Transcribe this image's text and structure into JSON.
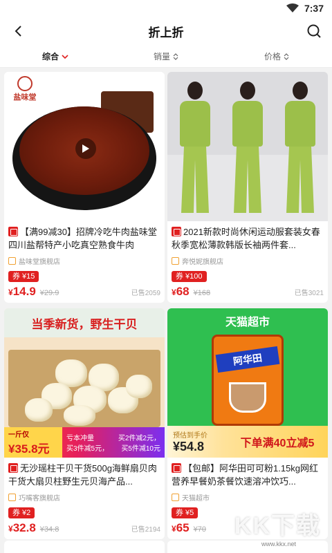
{
  "status_bar": {
    "time": "7:37"
  },
  "header": {
    "title": "折上折"
  },
  "sort": [
    {
      "label": "综合",
      "active": true
    },
    {
      "label": "销量",
      "active": false
    },
    {
      "label": "价格",
      "active": false
    }
  ],
  "products": [
    {
      "title": "【满99减30】招牌冷吃牛肉盐味堂四川盐帮特产小吃真空熟食牛肉",
      "shop": "盐味堂旗舰店",
      "coupon": "券 ¥15",
      "price": "14.9",
      "old_price": "¥29.9",
      "sold": "已售2059",
      "image_logo": "盐味堂"
    },
    {
      "title": "2021新款时尚休闲运动服套装女春秋季宽松薄款韩版长袖两件套...",
      "shop": "奔悦妮旗舰店",
      "coupon": "券 ¥100",
      "price": "68",
      "old_price": "¥168",
      "sold": "已售3021"
    },
    {
      "title": "无沙瑶柱干贝干货500g海鲜扇贝肉干货大扇贝柱野生元贝海产品...",
      "shop": "巧嘴客旗舰店",
      "coupon": "券 ¥2",
      "price": "32.8",
      "old_price": "¥34.8",
      "sold": "已售2194",
      "image_banner": "当季新货，野生干贝",
      "image_price_small": "一斤仅",
      "image_price_big": "¥35.8元",
      "image_tags": [
        "亏本冲量",
        "买2件减2元，",
        "买3件减5元，",
        "买5件减10元"
      ]
    },
    {
      "title": "【包邮】阿华田可可粉1.15kg网红营养早餐奶茶餐饮速溶冲饮巧...",
      "shop": "天猫超市",
      "coupon": "券 ¥5",
      "price": "65",
      "old_price": "¥70",
      "sold": "",
      "image_brand": "天猫超市",
      "image_can_label": "阿华田",
      "image_price_small": "预估到手价",
      "image_price_big": "¥54.8",
      "image_promo": "下单满40立减5"
    }
  ],
  "watermark": {
    "text": "KK下载",
    "sub": "www.kkx.net"
  }
}
